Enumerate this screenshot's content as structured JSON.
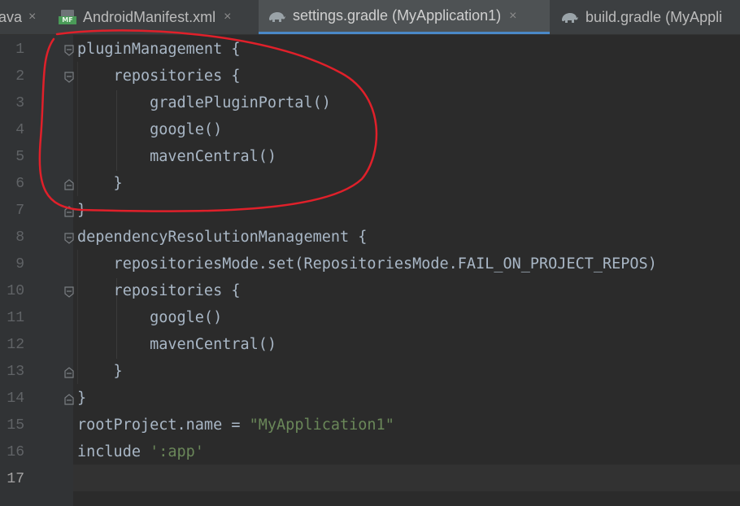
{
  "tabs": [
    {
      "label": "ava",
      "icon": "none",
      "active": false
    },
    {
      "label": "AndroidManifest.xml",
      "icon": "manifest-file-icon",
      "icon_badge": "MF",
      "active": false
    },
    {
      "label": "settings.gradle (MyApplication1)",
      "icon": "gradle-elephant-icon",
      "active": true
    },
    {
      "label": "build.gradle (MyAppli",
      "icon": "gradle-elephant-icon",
      "active": false
    }
  ],
  "close_glyph": "×",
  "current_line": 17,
  "line_numbers": [
    "1",
    "2",
    "3",
    "4",
    "5",
    "6",
    "7",
    "8",
    "9",
    "10",
    "11",
    "12",
    "13",
    "14",
    "15",
    "16",
    "17"
  ],
  "code": [
    {
      "text": "pluginManagement {"
    },
    {
      "text": "    repositories {"
    },
    {
      "text": "        gradlePluginPortal()"
    },
    {
      "text": "        google()"
    },
    {
      "text": "        mavenCentral()"
    },
    {
      "text": "    }"
    },
    {
      "text": "}"
    },
    {
      "text": "dependencyResolutionManagement {"
    },
    {
      "text": "    repositoriesMode.set(RepositoriesMode.FAIL_ON_PROJECT_REPOS)"
    },
    {
      "text": "    repositories {"
    },
    {
      "text": "        google()"
    },
    {
      "text": "        mavenCentral()"
    },
    {
      "text": "    }"
    },
    {
      "text": "}"
    },
    {
      "code": "rootProject.name = ",
      "string": "\"MyApplication1\""
    },
    {
      "code": "include ",
      "string": "':app'"
    },
    {
      "text": ""
    }
  ],
  "colors": {
    "background": "#2b2b2b",
    "gutter": "#313335",
    "code_text": "#a9b7c6",
    "string_literal": "#6a8759",
    "line_number": "#606366",
    "active_tab_underline": "#4a88c7",
    "annotation_circle": "#e0202a"
  }
}
